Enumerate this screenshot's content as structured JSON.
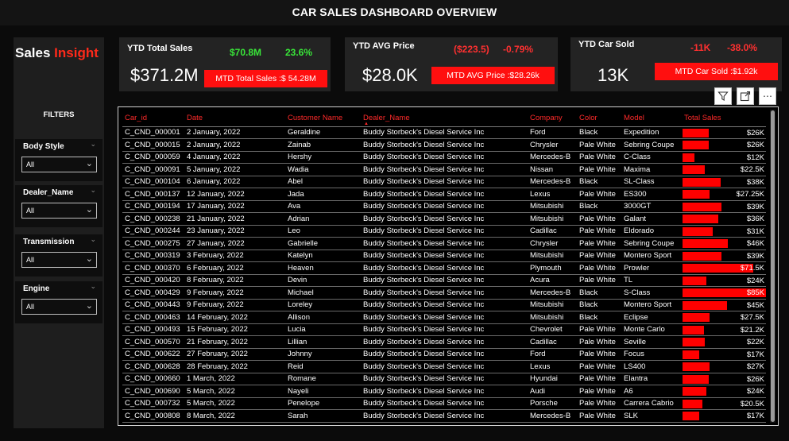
{
  "header": {
    "title": "CAR SALES DASHBOARD OVERVIEW"
  },
  "brand": {
    "part1": "Sales",
    "part2": "Insight",
    "accent": "#ff2a1a"
  },
  "filters": {
    "title": "FILTERS",
    "slicers": [
      {
        "label": "Body Style",
        "value": "All"
      },
      {
        "label": "Dealer_Name",
        "value": "All"
      },
      {
        "label": "Transmission",
        "value": "All"
      },
      {
        "label": "Engine",
        "value": "All"
      }
    ]
  },
  "kpis": [
    {
      "title": "YTD Total Sales",
      "value": "$371.2M",
      "delta_abs": "$70.8M",
      "delta_pct": "23.6%",
      "mtd": "MTD Total Sales :$ 54.28M",
      "trend": "up"
    },
    {
      "title": "YTD AVG Price",
      "value": "$28.0K",
      "delta_abs": "($223.5)",
      "delta_pct": "-0.79%",
      "mtd": "MTD AVG Price :$28.26k",
      "trend": "down"
    },
    {
      "title": "YTD Car Sold",
      "value": "13K",
      "delta_abs": "-11K",
      "delta_pct": "-38.0%",
      "mtd": "MTD Car Sold :$1.92k",
      "trend": "down"
    }
  ],
  "visual_icons": [
    "filter-icon",
    "focus-mode-icon",
    "more-options-icon"
  ],
  "colors": {
    "accent": "#ff0000",
    "positive": "#39e639",
    "negative": "#ff3030"
  },
  "table": {
    "columns": [
      "Car_id",
      "Date",
      "Customer Name",
      "Dealer_Name",
      "Company",
      "Color",
      "Model",
      "Total Sales"
    ],
    "sorted_column": "Dealer_Name",
    "rows": [
      {
        "car_id": "C_CND_000001",
        "date": "2 January, 2022",
        "customer": "Geraldine",
        "dealer": "Buddy Storbeck's Diesel Service Inc",
        "company": "Ford",
        "color": "Black",
        "model": "Expedition",
        "sales": "$26K",
        "amount": 26000
      },
      {
        "car_id": "C_CND_000015",
        "date": "2 January, 2022",
        "customer": "Zainab",
        "dealer": "Buddy Storbeck's Diesel Service Inc",
        "company": "Chrysler",
        "color": "Pale White",
        "model": "Sebring Coupe",
        "sales": "$26K",
        "amount": 26000
      },
      {
        "car_id": "C_CND_000059",
        "date": "4 January, 2022",
        "customer": "Hershy",
        "dealer": "Buddy Storbeck's Diesel Service Inc",
        "company": "Mercedes-B",
        "color": "Pale White",
        "model": "C-Class",
        "sales": "$12K",
        "amount": 12000
      },
      {
        "car_id": "C_CND_000091",
        "date": "5 January, 2022",
        "customer": "Wadia",
        "dealer": "Buddy Storbeck's Diesel Service Inc",
        "company": "Nissan",
        "color": "Pale White",
        "model": "Maxima",
        "sales": "$22.5K",
        "amount": 22500
      },
      {
        "car_id": "C_CND_000104",
        "date": "6 January, 2022",
        "customer": "Abel",
        "dealer": "Buddy Storbeck's Diesel Service Inc",
        "company": "Mercedes-B",
        "color": "Black",
        "model": "SL-Class",
        "sales": "$38K",
        "amount": 38000
      },
      {
        "car_id": "C_CND_000137",
        "date": "12 January, 2022",
        "customer": "Jada",
        "dealer": "Buddy Storbeck's Diesel Service Inc",
        "company": "Lexus",
        "color": "Pale White",
        "model": "ES300",
        "sales": "$27.25K",
        "amount": 27250
      },
      {
        "car_id": "C_CND_000194",
        "date": "17 January, 2022",
        "customer": "Ava",
        "dealer": "Buddy Storbeck's Diesel Service Inc",
        "company": "Mitsubishi",
        "color": "Black",
        "model": "3000GT",
        "sales": "$39K",
        "amount": 39000
      },
      {
        "car_id": "C_CND_000238",
        "date": "21 January, 2022",
        "customer": "Adrian",
        "dealer": "Buddy Storbeck's Diesel Service Inc",
        "company": "Mitsubishi",
        "color": "Pale White",
        "model": "Galant",
        "sales": "$36K",
        "amount": 36000
      },
      {
        "car_id": "C_CND_000244",
        "date": "23 January, 2022",
        "customer": "Leo",
        "dealer": "Buddy Storbeck's Diesel Service Inc",
        "company": "Cadillac",
        "color": "Pale White",
        "model": "Eldorado",
        "sales": "$31K",
        "amount": 31000
      },
      {
        "car_id": "C_CND_000275",
        "date": "27 January, 2022",
        "customer": "Gabrielle",
        "dealer": "Buddy Storbeck's Diesel Service Inc",
        "company": "Chrysler",
        "color": "Pale White",
        "model": "Sebring Coupe",
        "sales": "$46K",
        "amount": 46000
      },
      {
        "car_id": "C_CND_000319",
        "date": "3 February, 2022",
        "customer": "Katelyn",
        "dealer": "Buddy Storbeck's Diesel Service Inc",
        "company": "Mitsubishi",
        "color": "Pale White",
        "model": "Montero Sport",
        "sales": "$39K",
        "amount": 39000
      },
      {
        "car_id": "C_CND_000370",
        "date": "6 February, 2022",
        "customer": "Heaven",
        "dealer": "Buddy Storbeck's Diesel Service Inc",
        "company": "Plymouth",
        "color": "Pale White",
        "model": "Prowler",
        "sales": "$71.5K",
        "amount": 71500
      },
      {
        "car_id": "C_CND_000420",
        "date": "8 February, 2022",
        "customer": "Devin",
        "dealer": "Buddy Storbeck's Diesel Service Inc",
        "company": "Acura",
        "color": "Pale White",
        "model": "TL",
        "sales": "$24K",
        "amount": 24000
      },
      {
        "car_id": "C_CND_000429",
        "date": "9 February, 2022",
        "customer": "Michael",
        "dealer": "Buddy Storbeck's Diesel Service Inc",
        "company": "Mercedes-B",
        "color": "Black",
        "model": "S-Class",
        "sales": "$85K",
        "amount": 85000
      },
      {
        "car_id": "C_CND_000443",
        "date": "9 February, 2022",
        "customer": "Loreley",
        "dealer": "Buddy Storbeck's Diesel Service Inc",
        "company": "Mitsubishi",
        "color": "Black",
        "model": "Montero Sport",
        "sales": "$45K",
        "amount": 45000
      },
      {
        "car_id": "C_CND_000463",
        "date": "14 February, 2022",
        "customer": "Allison",
        "dealer": "Buddy Storbeck's Diesel Service Inc",
        "company": "Mitsubishi",
        "color": "Black",
        "model": "Eclipse",
        "sales": "$27.5K",
        "amount": 27500
      },
      {
        "car_id": "C_CND_000493",
        "date": "15 February, 2022",
        "customer": "Lucia",
        "dealer": "Buddy Storbeck's Diesel Service Inc",
        "company": "Chevrolet",
        "color": "Pale White",
        "model": "Monte Carlo",
        "sales": "$21.2K",
        "amount": 21200
      },
      {
        "car_id": "C_CND_000570",
        "date": "21 February, 2022",
        "customer": "Lillian",
        "dealer": "Buddy Storbeck's Diesel Service Inc",
        "company": "Cadillac",
        "color": "Pale White",
        "model": "Seville",
        "sales": "$22K",
        "amount": 22000
      },
      {
        "car_id": "C_CND_000622",
        "date": "27 February, 2022",
        "customer": "Johnny",
        "dealer": "Buddy Storbeck's Diesel Service Inc",
        "company": "Ford",
        "color": "Pale White",
        "model": "Focus",
        "sales": "$17K",
        "amount": 17000
      },
      {
        "car_id": "C_CND_000628",
        "date": "28 February, 2022",
        "customer": "Reid",
        "dealer": "Buddy Storbeck's Diesel Service Inc",
        "company": "Lexus",
        "color": "Pale White",
        "model": "LS400",
        "sales": "$27K",
        "amount": 27000
      },
      {
        "car_id": "C_CND_000660",
        "date": "1 March, 2022",
        "customer": "Romane",
        "dealer": "Buddy Storbeck's Diesel Service Inc",
        "company": "Hyundai",
        "color": "Pale White",
        "model": "Elantra",
        "sales": "$26K",
        "amount": 26000
      },
      {
        "car_id": "C_CND_000690",
        "date": "5 March, 2022",
        "customer": "Nayeli",
        "dealer": "Buddy Storbeck's Diesel Service Inc",
        "company": "Audi",
        "color": "Pale White",
        "model": "A6",
        "sales": "$24K",
        "amount": 24000
      },
      {
        "car_id": "C_CND_000732",
        "date": "5 March, 2022",
        "customer": "Penelope",
        "dealer": "Buddy Storbeck's Diesel Service Inc",
        "company": "Porsche",
        "color": "Pale White",
        "model": "Carrera Cabrio",
        "sales": "$20.5K",
        "amount": 20500
      },
      {
        "car_id": "C_CND_000808",
        "date": "8 March, 2022",
        "customer": "Sarah",
        "dealer": "Buddy Storbeck's Diesel Service Inc",
        "company": "Mercedes-B",
        "color": "Pale White",
        "model": "SLK",
        "sales": "$17K",
        "amount": 17000
      }
    ]
  }
}
